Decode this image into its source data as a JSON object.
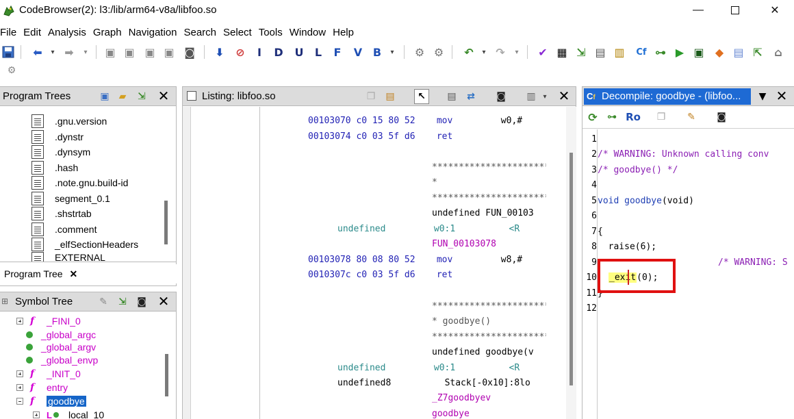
{
  "window": {
    "title": "CodeBrowser(2): l3:/lib/arm64-v8a/libfoo.so"
  },
  "menu": [
    "File",
    "Edit",
    "Analysis",
    "Graph",
    "Navigation",
    "Search",
    "Select",
    "Tools",
    "Window",
    "Help"
  ],
  "toolbar": {
    "letters": [
      "I",
      "D",
      "U",
      "L",
      "F",
      "V",
      "B"
    ]
  },
  "program_trees": {
    "title": "Program Trees",
    "items": [
      ".gnu.version",
      ".dynstr",
      ".dynsym",
      ".hash",
      ".note.gnu.build-id",
      "segment_0.1",
      ".shstrtab",
      ".comment",
      "_elfSectionHeaders",
      "EXTERNAL"
    ],
    "tab_label": "Program Tree"
  },
  "symbol_tree": {
    "title": "Symbol Tree",
    "items": [
      {
        "label": "_FINI_0",
        "kind": "func",
        "exp": "plus"
      },
      {
        "label": "_global_argc",
        "kind": "dot"
      },
      {
        "label": "_global_argv",
        "kind": "dot"
      },
      {
        "label": "_global_envp",
        "kind": "dot"
      },
      {
        "label": "_INIT_0",
        "kind": "func",
        "exp": "plus"
      },
      {
        "label": "entry",
        "kind": "func",
        "exp": "plus"
      },
      {
        "label": "goodbye",
        "kind": "func",
        "exp": "minus",
        "selected": true
      },
      {
        "label": "local_10",
        "kind": "local",
        "exp": "plus"
      }
    ]
  },
  "listing": {
    "title": "Listing:  libfoo.so",
    "lines": [
      {
        "addr": "00103070",
        "bytes": "c0 15 80 52",
        "mnem": "mov",
        "ops": "w0,#"
      },
      {
        "addr": "00103074",
        "bytes": "c0 03 5f d6",
        "mnem": "ret",
        "ops": ""
      },
      {
        "stars": "**************************"
      },
      {
        "stars": "*"
      },
      {
        "stars": "**************************"
      },
      {
        "undef_sig": "undefined FUN_00103"
      },
      {
        "param": "undefined",
        "reg": "w0:1",
        "ref": "<R"
      },
      {
        "label": "FUN_00103078"
      },
      {
        "addr": "00103078",
        "bytes": "80 08 80 52",
        "mnem": "mov",
        "ops": "w8,#"
      },
      {
        "addr": "0010307c",
        "bytes": "c0 03 5f d6",
        "mnem": "ret",
        "ops": ""
      },
      {
        "stars": "**************************"
      },
      {
        "stars": "* goodbye()"
      },
      {
        "stars": "**************************"
      },
      {
        "undef_sig": "undefined goodbye(v"
      },
      {
        "param": "undefined",
        "reg": "w0:1",
        "ref": "<R"
      },
      {
        "param": "undefined8",
        "reg": "Stack[-0x10]:8",
        "ref": "lo"
      },
      {
        "label": "_Z7goodbyev"
      },
      {
        "label": "goodbye"
      }
    ]
  },
  "decompile": {
    "title": "Decompile: goodbye -  (libfoo...",
    "line_numbers": [
      "1",
      "2",
      "3",
      "4",
      "5",
      "6",
      "7",
      "8",
      "9",
      "10",
      "11",
      "12"
    ],
    "lines": {
      "l2": "/* WARNING: Unknown calling conv",
      "l3": "/* goodbye() */",
      "l5_kw": "void",
      "l5_name": "goodbye",
      "l5_rest": "(void)",
      "l7": "{",
      "l8": "  raise(6);",
      "l9": "/* WARNING: S",
      "l10_fn": "_exit",
      "l10_rest": "(0);",
      "l11": "}"
    }
  }
}
